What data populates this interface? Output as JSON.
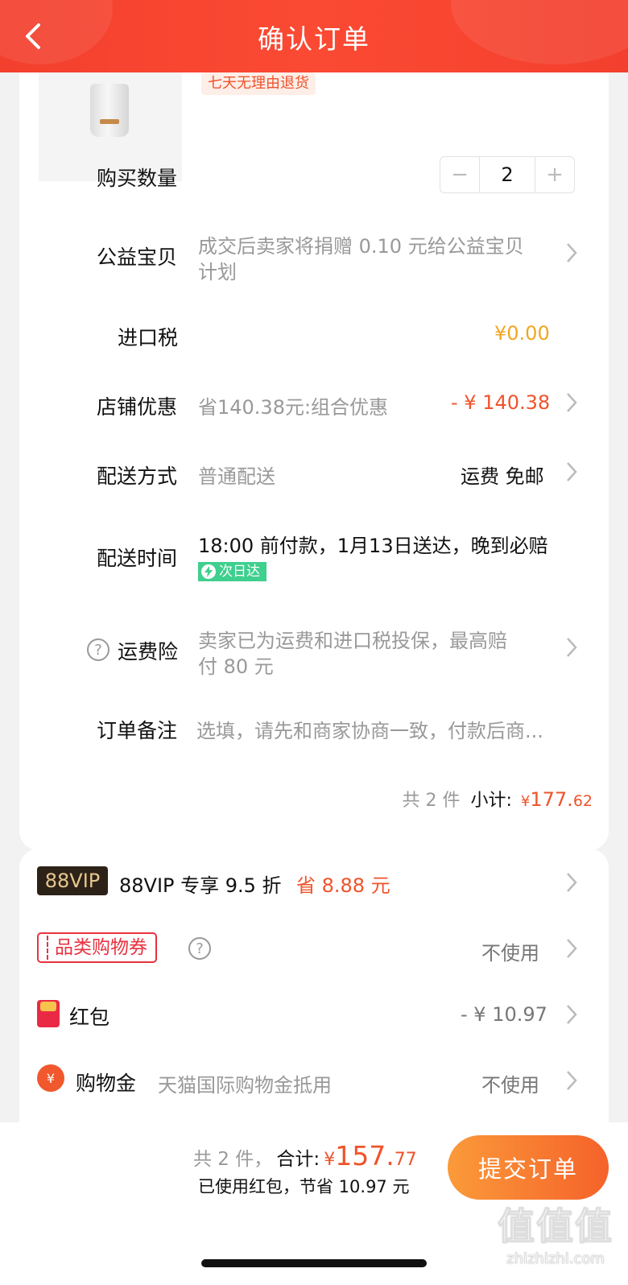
{
  "header": {
    "title": "确认订单"
  },
  "product": {
    "return_tag": "七天无理由退货"
  },
  "quantity": {
    "label": "购买数量",
    "value": "2",
    "minus": "−",
    "plus": "+"
  },
  "charity": {
    "label": "公益宝贝",
    "line1": "成交后卖家将捐赠 0.10 元给公益宝贝",
    "line2": "计划"
  },
  "import_tax": {
    "label": "进口税",
    "value": "¥0.00"
  },
  "store_discount": {
    "label": "店铺优惠",
    "desc": "省140.38元:组合优惠",
    "value": "- ¥ 140.38"
  },
  "delivery_method": {
    "label": "配送方式",
    "desc": "普通配送",
    "value": "运费 免邮"
  },
  "delivery_time": {
    "label": "配送时间",
    "desc": "18:00 前付款，1月13日送达，晚到必赔",
    "badge": "次日达"
  },
  "shipping_insurance": {
    "label": "运费险",
    "line1": "卖家已为运费和进口税投保，最高赔",
    "line2": "付 80 元"
  },
  "remark": {
    "label": "订单备注",
    "placeholder": "选填，请先和商家协商一致，付款后商..."
  },
  "subtotal": {
    "count": "共 2 件",
    "label": "小计:",
    "currency": "¥",
    "int": "177.",
    "dec": "62"
  },
  "vip": {
    "badge": "88VIP",
    "text": "88VIP 专享 9.5 折",
    "save": "省 8.88 元"
  },
  "coupon": {
    "badge": "品类购物券",
    "value": "不使用"
  },
  "red_packet": {
    "label": "红包",
    "value": "- ¥ 10.97"
  },
  "shopping_gold": {
    "label": "购物金",
    "desc": "天猫国际购物金抵用",
    "value": "不使用"
  },
  "bottom": {
    "count": "共 2 件，",
    "total_label": "合计:",
    "currency": "¥",
    "total_int": "157.",
    "total_dec": "77",
    "saving": "已使用红包，节省 10.97 元",
    "submit": "提交订单"
  },
  "watermark": {
    "main": "值值值",
    "sub": "zhizhizhi.com"
  },
  "colors": {
    "brand_red": "#f3402e",
    "price_orange": "#f0532b",
    "tax_gold": "#f0a623",
    "next_day_green": "#3fcf8e"
  }
}
